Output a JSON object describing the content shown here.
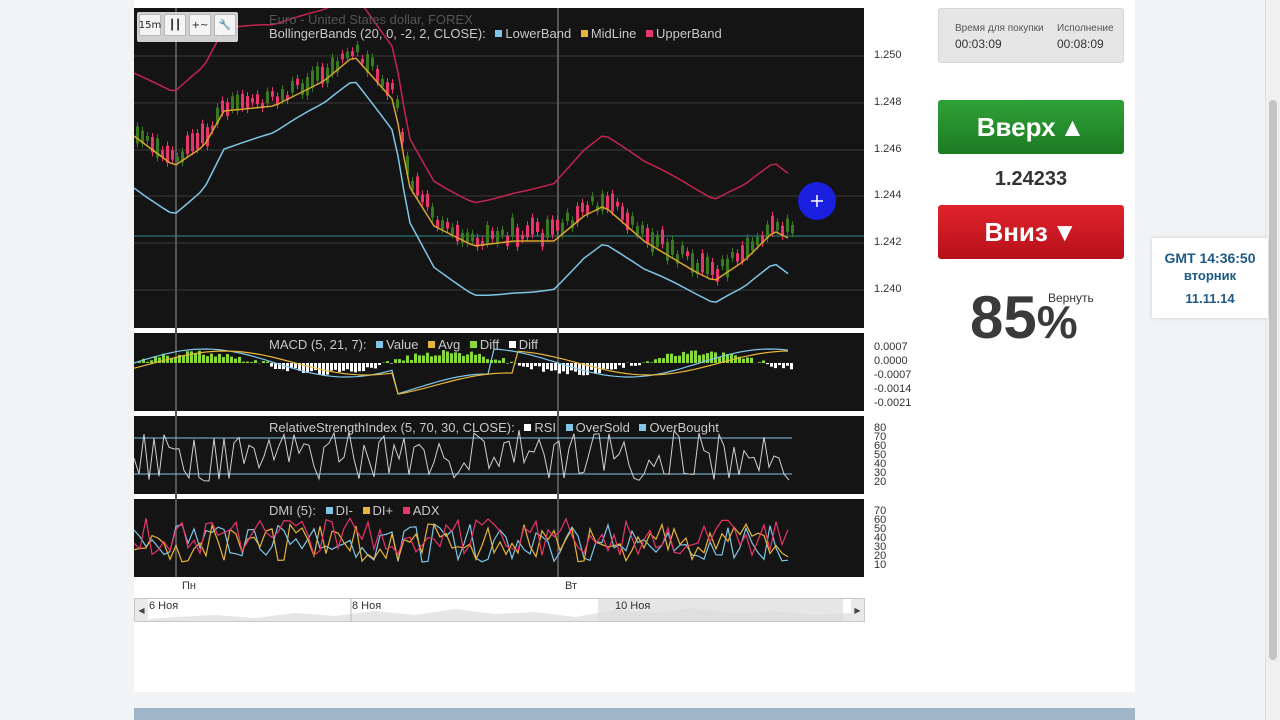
{
  "chart": {
    "symbol": "Euro - United States dollar, FOREX",
    "timeframe": "15m",
    "indicators": {
      "bollinger": {
        "label": "BollingerBands (20, 0, -2, 2, CLOSE):",
        "series": [
          {
            "name": "LowerBand",
            "color": "#7fc6e8"
          },
          {
            "name": "MidLine",
            "color": "#e7b539"
          },
          {
            "name": "UpperBand",
            "color": "#e8356a"
          }
        ]
      },
      "macd": {
        "label": "MACD (5, 21, 7):",
        "series": [
          {
            "name": "Value",
            "color": "#7fc6e8"
          },
          {
            "name": "Avg",
            "color": "#e7b539"
          },
          {
            "name": "Diff",
            "color": "#88d93a"
          },
          {
            "name": "Diff",
            "color": "#ffffff"
          }
        ]
      },
      "rsi": {
        "label": "RelativeStrengthIndex (5, 70, 30, CLOSE):",
        "series": [
          {
            "name": "RSI",
            "color": "#ffffff"
          },
          {
            "name": "OverSold",
            "color": "#7fc6e8"
          },
          {
            "name": "OverBought",
            "color": "#7fc6e8"
          }
        ]
      },
      "dmi": {
        "label": "DMI (5):",
        "series": [
          {
            "name": "DI-",
            "color": "#7fc6e8"
          },
          {
            "name": "DI+",
            "color": "#e7b539"
          },
          {
            "name": "ADX",
            "color": "#e8356a"
          }
        ]
      }
    },
    "price_axis": [
      "1.250",
      "1.248",
      "1.246",
      "1.244",
      "1.242",
      "1.240"
    ],
    "macd_axis": [
      "0.0007",
      "0.0000",
      "-0.0007",
      "-0.0014",
      "-0.0021"
    ],
    "rsi_axis": [
      "80",
      "70",
      "60",
      "50",
      "40",
      "30",
      "20"
    ],
    "dmi_axis": [
      "70",
      "60",
      "50",
      "40",
      "30",
      "20",
      "10"
    ],
    "day_labels": [
      "Пн",
      "Вт"
    ],
    "navigator_labels": [
      "6 Ноя",
      "8 Ноя",
      "10 Ноя"
    ]
  },
  "trade": {
    "buy_time_caption": "Время для покупки",
    "buy_time": "00:03:09",
    "exec_caption": "Исполнение",
    "exec_time": "00:08:09",
    "up_label": "Вверх",
    "up_arrow": "▲",
    "price": "1.24233",
    "down_label": "Вниз",
    "down_arrow": "▼",
    "payout": "85",
    "payout_unit": "%",
    "payout_caption": "Вернуть"
  },
  "clock": {
    "time": "GMT 14:36:50",
    "weekday": "вторник",
    "date": "11.11.14"
  },
  "colors": {
    "chart_bg": "#141414",
    "candle_up": "#3a7a1e",
    "candle_down": "#e8356a",
    "up_button": "#1f8a26",
    "down_button": "#c8141e",
    "clock_text": "#1d5a86"
  }
}
